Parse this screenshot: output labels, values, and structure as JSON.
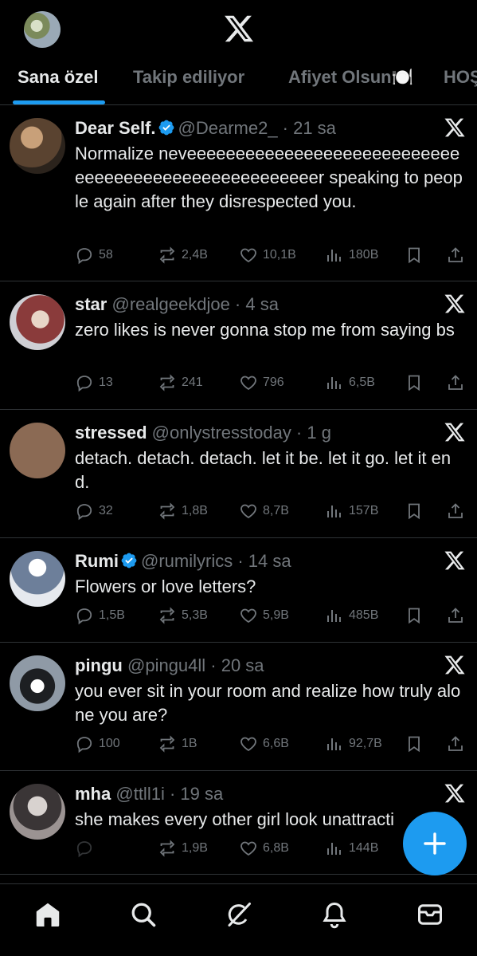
{
  "header": {
    "tabs": [
      "Sana özel",
      "Takip ediliyor",
      "Afiyet Olsun🍽️",
      "HOŞ"
    ]
  },
  "tweets": [
    {
      "name": "Dear Self.",
      "verified": true,
      "handle": "@Dearme2_ · 21 sa",
      "text": "Normalize neveeeeeeeeeeeeeeeeeeeeeeeeeeeeeeeeeeeeeeeeeeeeeeeeeeeeer speaking to people again after they disrespected you.",
      "replies": "58",
      "reposts": "2,4B",
      "likes": "10,1B",
      "views": "180B",
      "avatar_color": "#4a3b2c"
    },
    {
      "name": "star",
      "verified": false,
      "handle": "@realgeekdjoe · 4 sa",
      "text": "zero likes is never gonna stop me from saying bs",
      "replies": "13",
      "reposts": "241",
      "likes": "796",
      "views": "6,5B",
      "avatar_color": "#8a3b3b"
    },
    {
      "name": "stressed",
      "verified": false,
      "handle": "@onlystresstoday · 1 g",
      "text": "detach. detach. detach. let it be. let it go. let it end.",
      "replies": "32",
      "reposts": "1,8B",
      "likes": "8,7B",
      "views": "157B",
      "avatar_color": "#8b6a54"
    },
    {
      "name": "Rumi",
      "verified": true,
      "handle": "@rumilyrics · 14 sa",
      "text": "Flowers or love letters?",
      "replies": "1,5B",
      "reposts": "5,3B",
      "likes": "5,9B",
      "views": "485B",
      "avatar_color": "#c9cfd6"
    },
    {
      "name": "pingu",
      "verified": false,
      "handle": "@pingu4ll · 20 sa",
      "text": "you ever sit in your room and realize how truly alone you are?",
      "replies": "100",
      "reposts": "1B",
      "likes": "6,6B",
      "views": "92,7B",
      "avatar_color": "#5b6470"
    },
    {
      "name": "mha",
      "verified": false,
      "handle": "@ttll1i · 19 sa",
      "text": "she makes every other girl look unattracti",
      "replies": "",
      "reposts": "1,9B",
      "likes": "6,8B",
      "views": "144B",
      "avatar_color": "#7a7a7a"
    }
  ],
  "colors": {
    "accent": "#1d9bf0",
    "muted": "#71767b",
    "text": "#e7e9ea",
    "border": "#2f3336"
  },
  "bottom_nav": [
    "home-icon",
    "search-icon",
    "grok-icon",
    "notifications-icon",
    "messages-icon"
  ]
}
